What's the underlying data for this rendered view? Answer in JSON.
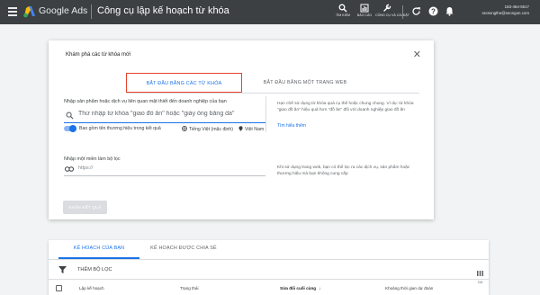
{
  "header": {
    "brand": "Google Ads",
    "title": "Công cụ lập kế hoạch từ khóa",
    "tools": [
      {
        "label": "TÌM KIẾM",
        "icon": "search-icon"
      },
      {
        "label": "BÁO CÁO",
        "icon": "reports-icon"
      },
      {
        "label": "CÔNG CỤ VÀ CÀI ĐẶT",
        "icon": "wrench-icon"
      }
    ],
    "account_number": "153-464-5517",
    "account_email": "seotongthe@seongon.com"
  },
  "modal": {
    "title": "Khám phá các từ khóa mới",
    "tabs": [
      {
        "label": "BẮT ĐẦU BẰNG CÁC TỪ KHÓA",
        "active": true
      },
      {
        "label": "BẮT ĐẦU BẰNG MỘT TRANG WEB",
        "active": false
      }
    ],
    "keyword_section_label": "Nhập sản phẩm hoặc dịch vụ liên quan mật thiết đến doanh nghiệp của bạn",
    "keyword_placeholder": "Thử nhập từ khóa \"giao đồ ăn\" hoặc \"giày ống bằng da\"",
    "include_brands_label": "Bao gồm tên thương hiệu trong kết quả",
    "include_brands_on": true,
    "language": "Tiếng Việt (mặc định)",
    "location": "Việt Nam",
    "keyword_help": "Hạn chế sử dụng từ khóa quá cụ thể hoặc chung chung. Ví dụ: từ khóa \"giao đồ ăn\" hiệu quả hơn \"đồ ăn\" đối với doanh nghiệp giao đồ ăn",
    "help_link": "Tìm hiểu thêm",
    "domain_section_label": "Nhập một miền làm bộ lọc",
    "domain_placeholder": "https://",
    "domain_help": "Khi sử dụng trang web, bạn có thể lọc ra các dịch vụ, sản phẩm hoặc thương hiệu mà bạn không cung cấp",
    "get_results_label": "NHẬN KẾT QUẢ"
  },
  "plans": {
    "tabs": [
      {
        "label": "KẾ HOẠCH CỦA BẠN",
        "active": true
      },
      {
        "label": "KẾ HOẠCH ĐƯỢC CHIA SẺ",
        "active": false
      }
    ],
    "add_filter_label": "THÊM BỘ LỌC",
    "columns_label": "Cột",
    "columns": [
      {
        "label": "Lập kế hoạch",
        "sorted": false
      },
      {
        "label": "Trạng thái",
        "sorted": false
      },
      {
        "label": "Sửa đổi cuối cùng",
        "sorted": true
      },
      {
        "label": "Khoảng thời gian dự đoán",
        "sorted": false
      }
    ]
  },
  "colors": {
    "topbar": "#3c4043",
    "accent": "#1a73e8",
    "highlight_box": "#e8432b",
    "background": "#f1f3f4"
  }
}
